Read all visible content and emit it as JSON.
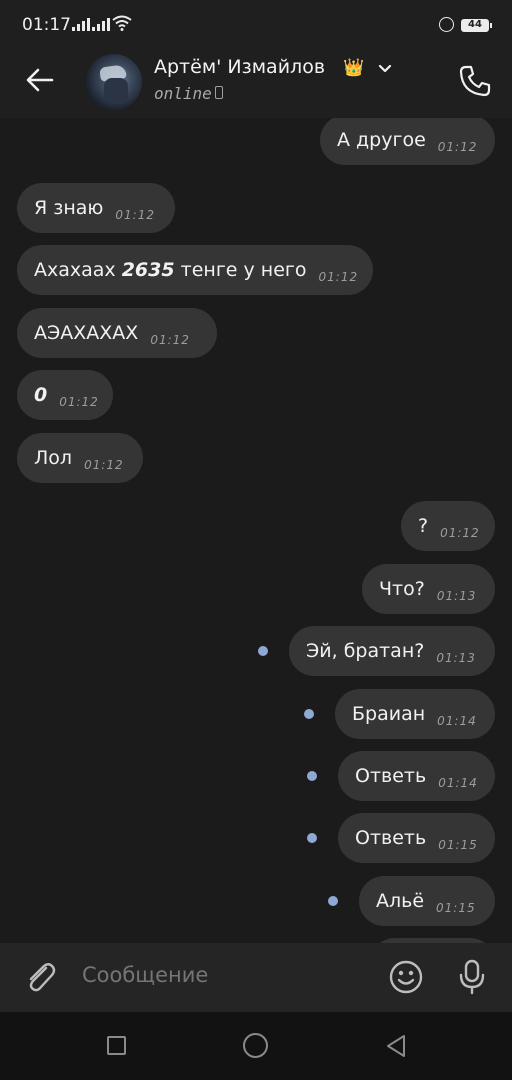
{
  "status_bar": {
    "time": "01:17",
    "battery": "44"
  },
  "header": {
    "contact_name": "Артём' Измайлов",
    "crown_icon": "👑",
    "status": "online",
    "icons": [
      "back-arrow-icon",
      "chevron-down-icon",
      "phone-icon"
    ]
  },
  "messages": [
    {
      "text": "А другое",
      "time": "01:12",
      "out": true
    },
    {
      "text": "Я знаю",
      "time": "01:12",
      "out": false
    },
    {
      "text_pre": "Ахахаах ",
      "text_bold": "2635",
      "text_post": " тенге у него",
      "time": "01:12",
      "out": false
    },
    {
      "text": "АЭАХАХАХ",
      "time": "01:12",
      "out": false
    },
    {
      "text_bold": "0",
      "time": "01:12",
      "out": false
    },
    {
      "text": "Лол",
      "time": "01:12",
      "out": false
    },
    {
      "text": "?",
      "time": "01:12",
      "out": true
    },
    {
      "text": "Что?",
      "time": "01:13",
      "out": true
    },
    {
      "text": "Эй, братан?",
      "time": "01:13",
      "out": true,
      "unread": true
    },
    {
      "text": "Браиан",
      "time": "01:14",
      "out": true,
      "unread": true
    },
    {
      "text": "Ответь",
      "time": "01:14",
      "out": true,
      "unread": true
    },
    {
      "text": "Ответь",
      "time": "01:15",
      "out": true,
      "unread": true
    },
    {
      "text": "Альё",
      "time": "01:15",
      "out": true,
      "unread": true
    }
  ],
  "input": {
    "placeholder": "Сообщение"
  },
  "colors": {
    "background": "#1b1b1b",
    "bubble": "#353535",
    "unread_dot": "#8fa9d6",
    "header": "#1f1f1f"
  }
}
